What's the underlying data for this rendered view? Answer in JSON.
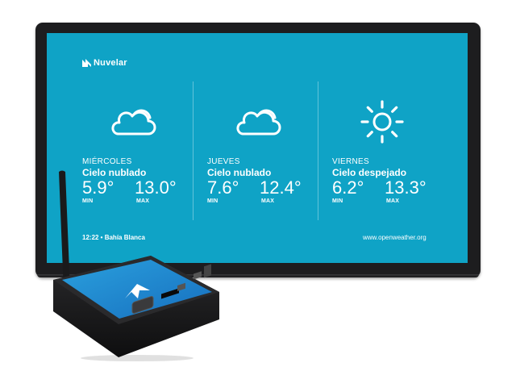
{
  "brand": {
    "name": "Nuvelar"
  },
  "forecast": [
    {
      "day": "MIÉRCOLES",
      "condition": "Cielo nublado",
      "icon": "cloud-icon",
      "min": "5.9°",
      "max": "13.0°",
      "min_label": "MIN",
      "max_label": "MAX"
    },
    {
      "day": "JUEVES",
      "condition": "Cielo nublado",
      "icon": "cloud-icon",
      "min": "7.6°",
      "max": "12.4°",
      "min_label": "MIN",
      "max_label": "MAX"
    },
    {
      "day": "VIERNES",
      "condition": "Cielo despejado",
      "icon": "sun-icon",
      "min": "6.2°",
      "max": "13.3°",
      "min_label": "MIN",
      "max_label": "MAX"
    }
  ],
  "footer": {
    "time_location": "12:22 • Bahía Blanca",
    "source": "www.openweather.org"
  },
  "colors": {
    "screen": "#0fa3c6",
    "bezel": "#1d1d1f",
    "device_top": "#1f8ccf"
  }
}
